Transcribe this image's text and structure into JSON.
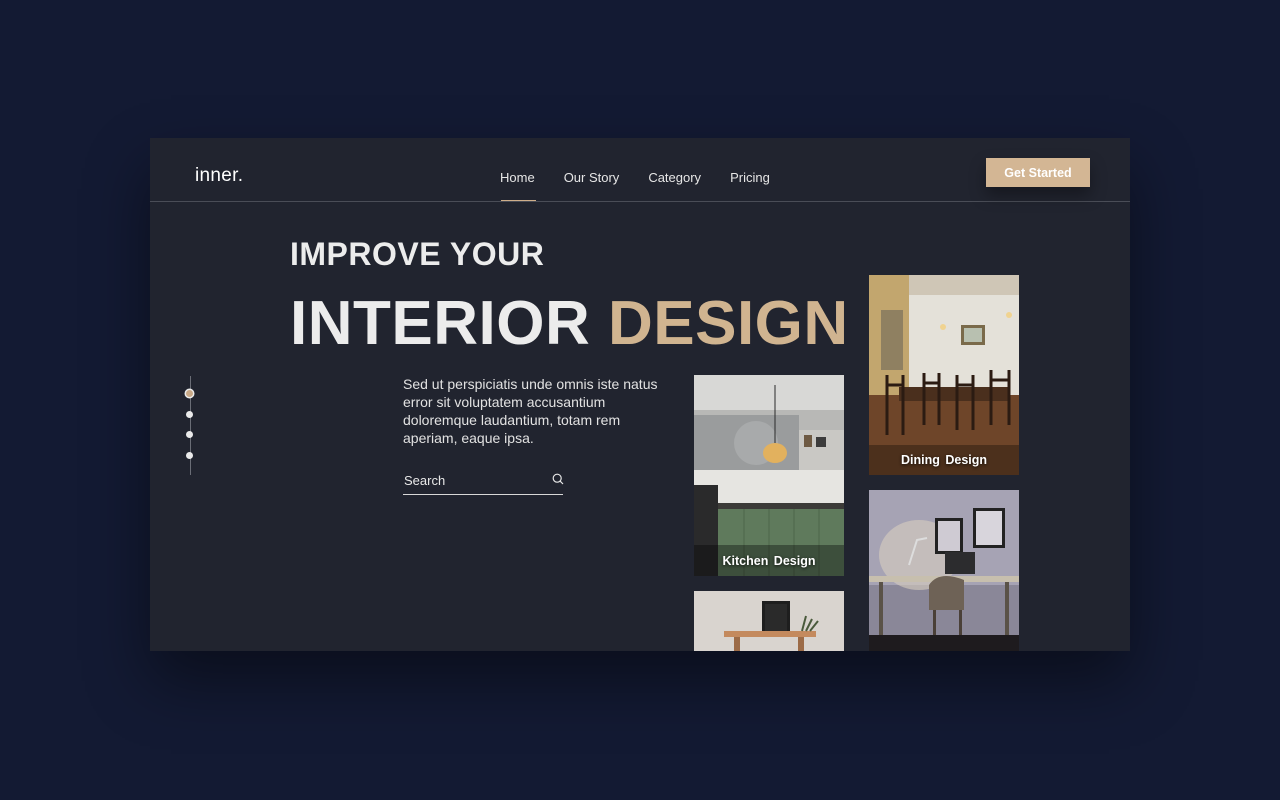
{
  "brand": {
    "logo": "inner."
  },
  "nav": {
    "items": [
      {
        "label": "Home",
        "active": true
      },
      {
        "label": "Our Story",
        "active": false
      },
      {
        "label": "Category",
        "active": false
      },
      {
        "label": "Pricing",
        "active": false
      }
    ],
    "cta_label": "Get Started"
  },
  "hero": {
    "line1": "IMPROVE YOUR",
    "line2_main": "INTERIOR",
    "line2_accent": "DESIGN",
    "description": "Sed ut perspiciatis unde omnis iste natus error sit voluptatem accusantium doloremque laudantium, totam rem aperiam, eaque ipsa."
  },
  "search": {
    "placeholder": "Search",
    "icon": "search-icon"
  },
  "slider": {
    "count": 4,
    "active_index": 0
  },
  "gallery": [
    {
      "label": "Kitchen Design",
      "icon": "kitchen-photo"
    },
    {
      "label": "",
      "icon": "shelf-photo"
    },
    {
      "label": "Dining  Design",
      "icon": "dining-photo"
    },
    {
      "label": "",
      "icon": "workspace-photo"
    }
  ],
  "colors": {
    "page_background": "#131a33",
    "card_background": "#21242f",
    "accent": "#d0b490",
    "text": "#ececec"
  }
}
